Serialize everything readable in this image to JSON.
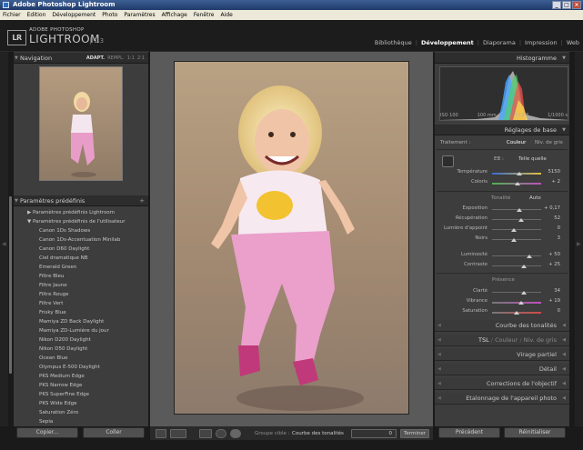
{
  "window": {
    "title": "Adobe Photoshop Lightroom"
  },
  "menu": [
    "Fichier",
    "Edition",
    "Développement",
    "Photo",
    "Paramètres",
    "Affichage",
    "Fenêtre",
    "Aide"
  ],
  "brand": {
    "line1": "ADOBE PHOTOSHOP",
    "line2": "LIGHTROOM",
    "version": "1.3",
    "badge": "LR"
  },
  "modules": [
    "Bibliothèque",
    "Développement",
    "Diaporama",
    "Impression",
    "Web"
  ],
  "navigator": {
    "title": "Navigation",
    "zoom": [
      "ADAPT.",
      "REMPL.",
      "1:1",
      "2:1"
    ]
  },
  "presets": {
    "title": "Paramètres prédéfinis",
    "plus": "+",
    "groups": [
      "Paramètres prédéfinis Lightroom",
      "Paramètres prédéfinis de l'utilisateur"
    ],
    "items": [
      "Canon 1Ds Shadows",
      "Canon 1Ds-Accentuation Minilab",
      "Canon D60 Daylight",
      "Ciel dramatique NB",
      "Emerald Green",
      "Filtre Bleu",
      "Filtre Jaune",
      "Filtre Rouge",
      "Filtre Vert",
      "Frisky Blue",
      "Mamiya ZD Back Daylight",
      "Mamiya ZD-Lumière du jour",
      "Nikon D200 Daylight",
      "Nikon D50 Daylight",
      "Ocean Blue",
      "Olympus E-500 Daylight",
      "PKS Medium Edge",
      "PKS Narrow Edge",
      "PKS SuperFine Edge",
      "PKS Wide Edge",
      "Saturation Zéro",
      "Sepia"
    ]
  },
  "left_buttons": {
    "copy": "Copier...",
    "paste": "Coller"
  },
  "toolbar": {
    "group_label": "Groupe cible :",
    "group_value": "Courbe des tonalités",
    "value": "0",
    "finish": "Terminer"
  },
  "histogram": {
    "title": "Histogramme",
    "iso": "ISO 100",
    "focal": "100 mm",
    "aperture": "f / 2,8",
    "shutter": "1/1000 s"
  },
  "basic": {
    "title": "Réglages de base",
    "treatment_label": "Traitement :",
    "treat_color": "Couleur",
    "treat_bw": "Niv. de gris",
    "wb_label": "EB :",
    "wb_value": "Telle quelle",
    "sliders1": [
      {
        "label": "Température",
        "value": "5150"
      },
      {
        "label": "Coloris",
        "value": "+ 2"
      }
    ],
    "tone_label": "Tonalité",
    "auto": "Auto",
    "sliders2": [
      {
        "label": "Exposition",
        "value": "+ 0,17"
      },
      {
        "label": "Récupération",
        "value": "52"
      },
      {
        "label": "Lumière d'appoint",
        "value": "0"
      },
      {
        "label": "Noirs",
        "value": "3"
      }
    ],
    "sliders3": [
      {
        "label": "Luminosité",
        "value": "+ 50"
      },
      {
        "label": "Contraste",
        "value": "+ 25"
      }
    ],
    "presence_label": "Présence",
    "sliders4": [
      {
        "label": "Clarté",
        "value": "34"
      },
      {
        "label": "Vibrance",
        "value": "+ 19"
      },
      {
        "label": "Saturation",
        "value": "0"
      }
    ]
  },
  "collapsed": {
    "curve": "Courbe des tonalités",
    "tsl1": "TSL",
    "tsl2": "Couleur",
    "tsl3": "Niv. de gris",
    "split": "Virage partiel",
    "detail": "Détail",
    "lens": "Corrections de l'objectif",
    "calib": "Etalonnage de l'appareil photo"
  },
  "right_buttons": {
    "previous": "Précédent",
    "reset": "Réinitialiser"
  }
}
